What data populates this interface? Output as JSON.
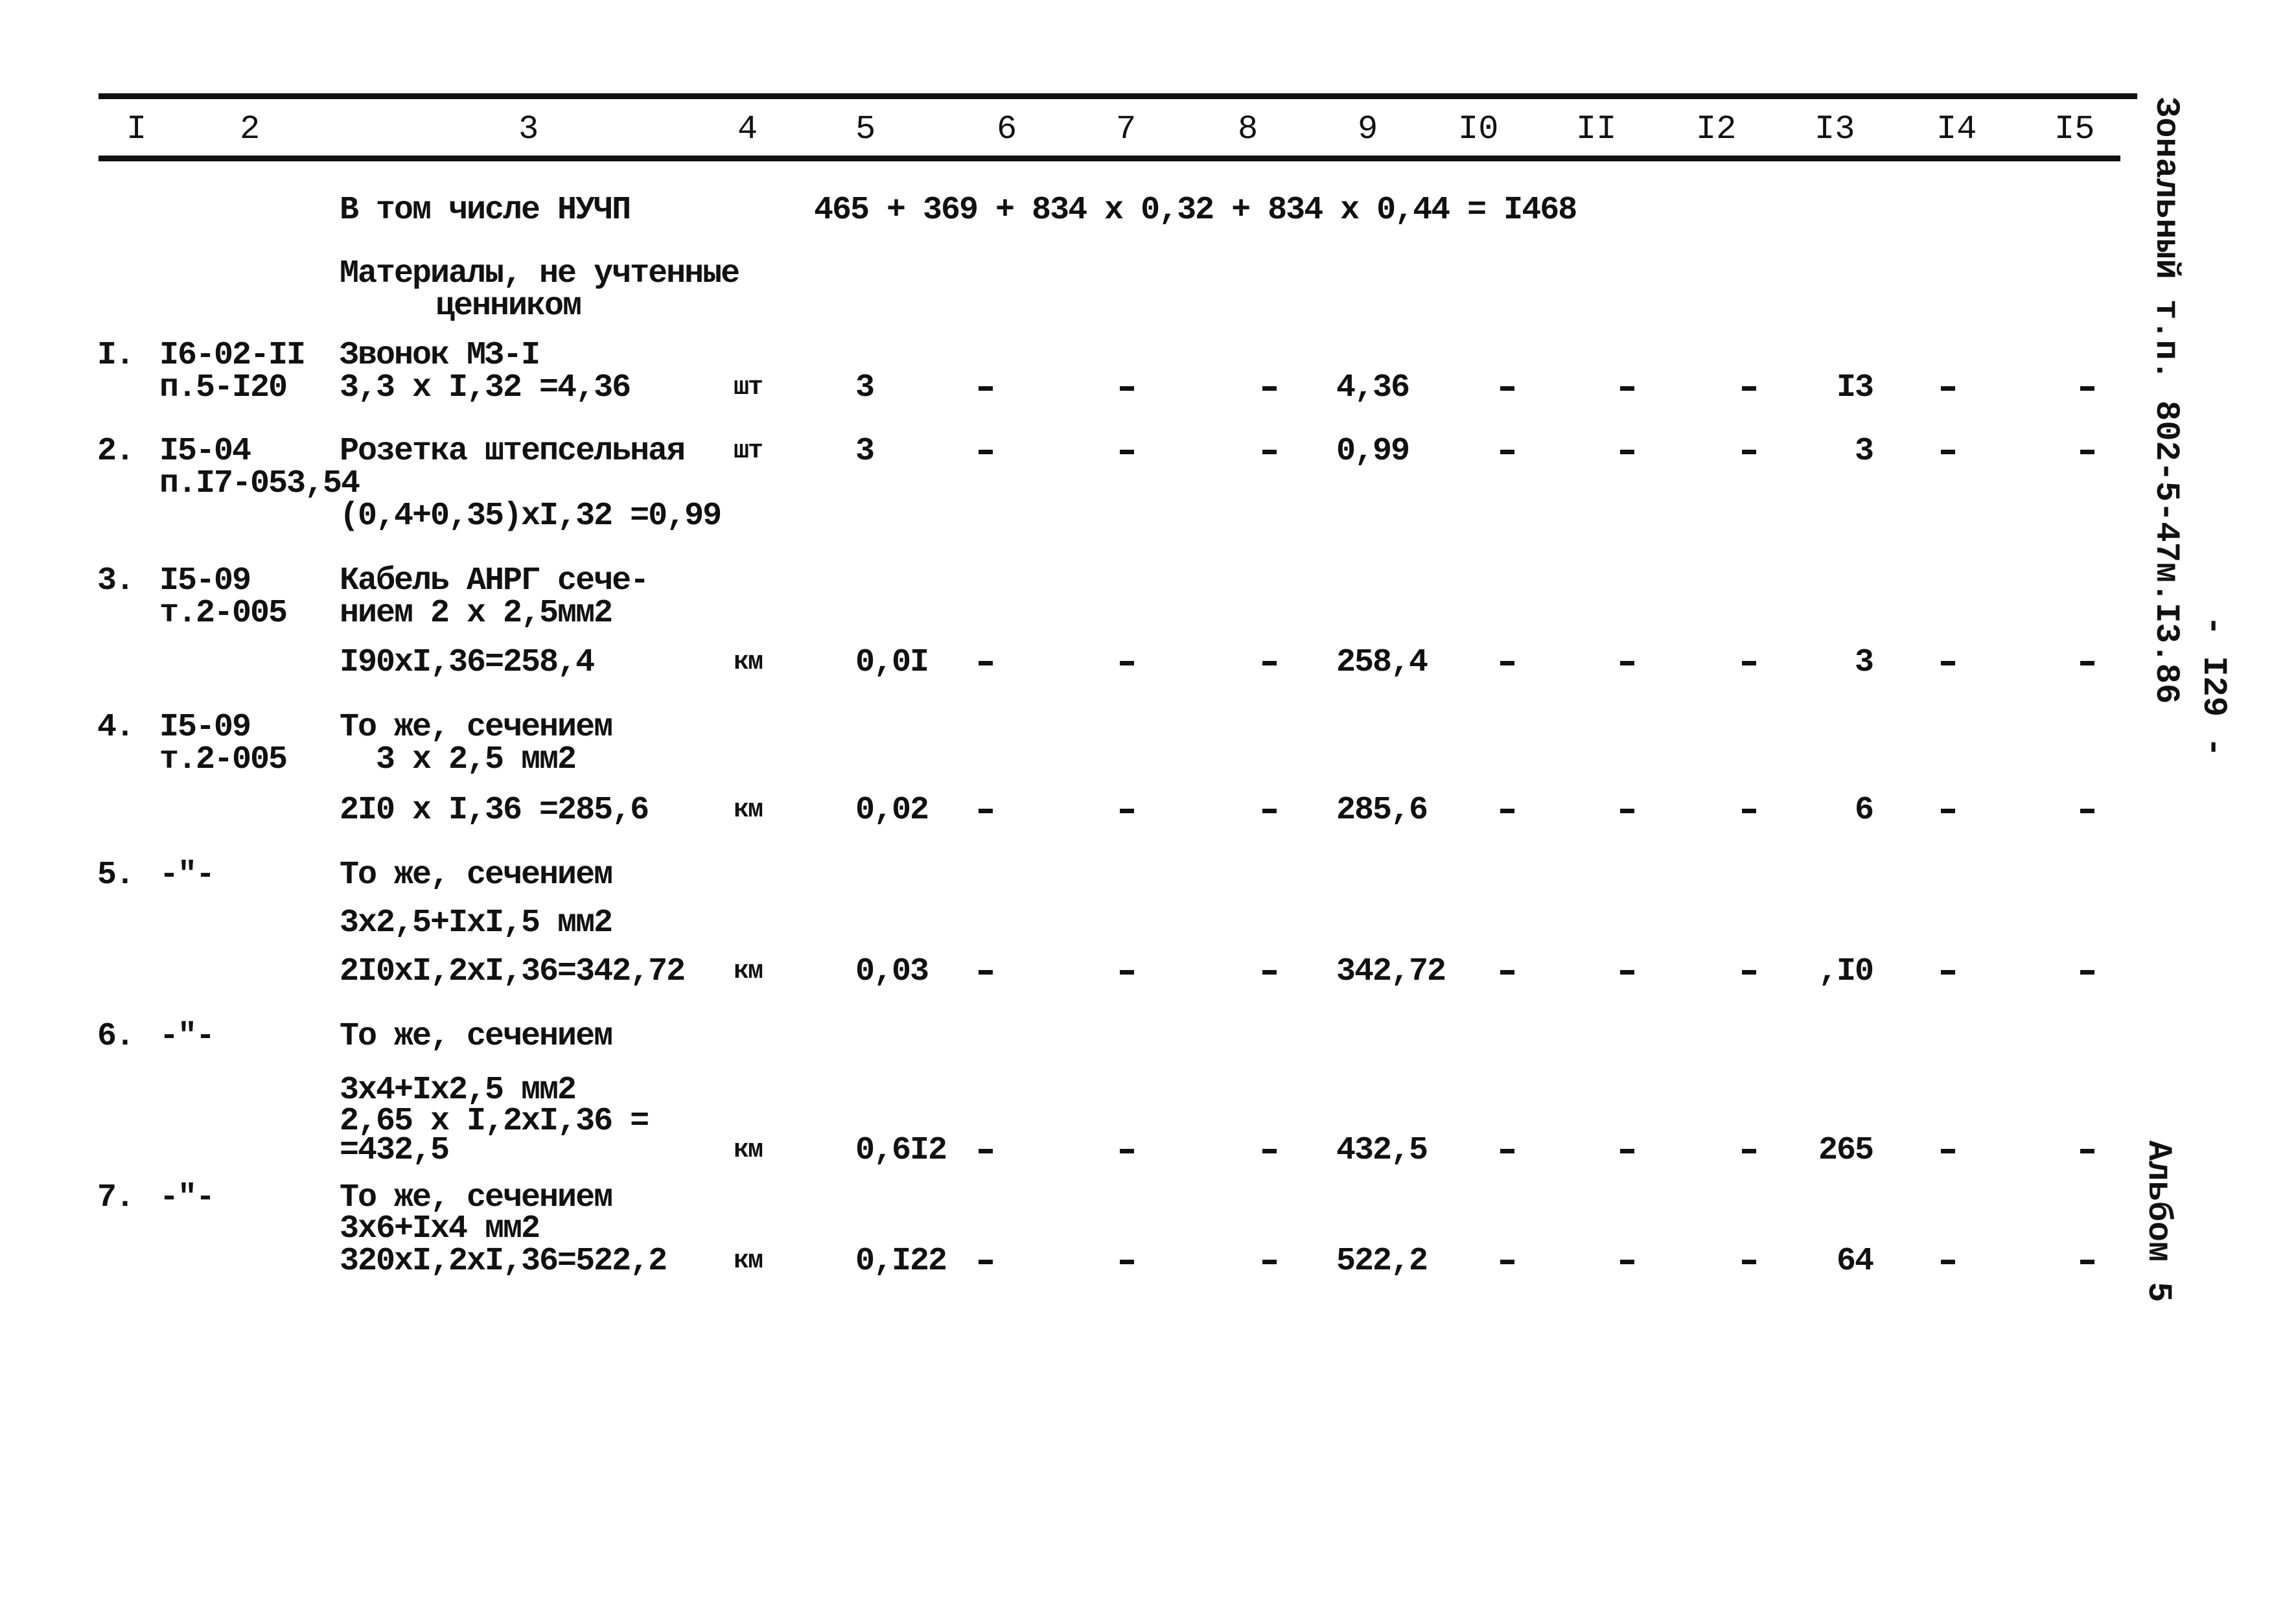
{
  "header": {
    "columns": [
      "I",
      "2",
      "3",
      "4",
      "5",
      "6",
      "7",
      "8",
      "9",
      "I0",
      "II",
      "I2",
      "I3",
      "I4",
      "I5"
    ]
  },
  "summary": {
    "label": "В том числе НУЧП",
    "formula": "465 + 369 + 834 x 0,32 + 834 x 0,44 = I468"
  },
  "section": {
    "title_line1": "Материалы, не учтенные",
    "title_line2": "ценником"
  },
  "rows": [
    {
      "num": "I.",
      "code1": "I6-02-II",
      "code2": "п.5-I20",
      "desc": [
        "Звонок МЗ-I",
        "3,3 x I,32 =4,36"
      ],
      "unit": "шт",
      "qty": "3",
      "c6": "-",
      "c7": "-",
      "c8": "-",
      "price": "4,36",
      "c10": "-",
      "c11": "-",
      "c12": "-",
      "total": "I3",
      "c14": "-",
      "c15": "-"
    },
    {
      "num": "2.",
      "code1": "I5-04",
      "code2": "п.I7-053,54",
      "desc": [
        "Розетка штепсельная",
        "(0,4+0,35)xI,32 =0,99"
      ],
      "unit": "шт",
      "qty": "3",
      "c6": "-",
      "c7": "-",
      "c8": "-",
      "price": "0,99",
      "c10": "-",
      "c11": "-",
      "c12": "-",
      "total": "3",
      "c14": "-",
      "c15": "-"
    },
    {
      "num": "3.",
      "code1": "I5-09",
      "code2": "т.2-005",
      "desc": [
        "Кабель АНРГ сече-",
        "нием 2 x 2,5мм2",
        "I90xI,36=258,4"
      ],
      "unit": "км",
      "qty": "0,0I",
      "c6": "-",
      "c7": "-",
      "c8": "-",
      "price": "258,4",
      "c10": "-",
      "c11": "-",
      "c12": "-",
      "total": "3",
      "c14": "-",
      "c15": "-"
    },
    {
      "num": "4.",
      "code1": "I5-09",
      "code2": "т.2-005",
      "desc": [
        "То же, сечением",
        "  3 x 2,5 мм2",
        "2I0 x I,36 =285,6"
      ],
      "unit": "км",
      "qty": "0,02",
      "c6": "-",
      "c7": "-",
      "c8": "-",
      "price": "285,6",
      "c10": "-",
      "c11": "-",
      "c12": "-",
      "total": "6",
      "c14": "-",
      "c15": "-"
    },
    {
      "num": "5.",
      "code1": "-\"-",
      "code2": "",
      "desc": [
        "То же, сечением",
        "3x2,5+IxI,5 мм2",
        "2I0xI,2xI,36=342,72"
      ],
      "unit": "км",
      "qty": "0,03",
      "c6": "-",
      "c7": "-",
      "c8": "-",
      "price": "342,72",
      "c10": "-",
      "c11": "-",
      "c12": "-",
      "total": ",I0",
      "c14": "-",
      "c15": "-"
    },
    {
      "num": "6.",
      "code1": "-\"-",
      "code2": "",
      "desc": [
        "То же, сечением",
        "3x4+Ix2,5 мм2",
        "2,65 x I,2xI,36 =",
        "=432,5"
      ],
      "unit": "км",
      "qty": "0,6I2",
      "c6": "-",
      "c7": "-",
      "c8": "-",
      "price": "432,5",
      "c10": "-",
      "c11": "-",
      "c12": "-",
      "total": "265",
      "c14": "-",
      "c15": "-"
    },
    {
      "num": "7.",
      "code1": "-\"-",
      "code2": "",
      "desc": [
        "То же, сечением",
        "3x6+Ix4 мм2",
        "320xI,2xI,36=522,2"
      ],
      "unit": "км",
      "qty": "0,I22",
      "c6": "-",
      "c7": "-",
      "c8": "-",
      "price": "522,2",
      "c10": "-",
      "c11": "-",
      "c12": "-",
      "total": "64",
      "c14": "-",
      "c15": "-"
    }
  ],
  "side": {
    "project_ref": "Зональный т.п. 802-5-47м.I3.86",
    "page_number": "- I29 -",
    "album": "Альбом 5"
  }
}
